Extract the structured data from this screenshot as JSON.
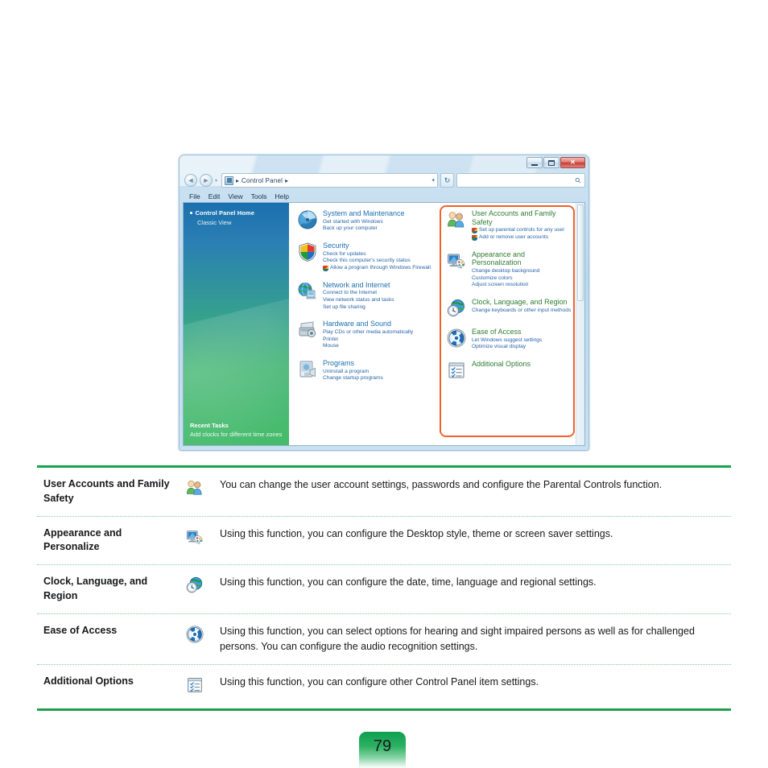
{
  "window": {
    "caption": {
      "minimize": "–",
      "maximize": "□",
      "close": "✕"
    },
    "nav": {
      "back_icon": "back-arrow-icon",
      "forward_icon": "forward-arrow-icon",
      "history_caret": "▾",
      "address_icon": "control-panel-icon",
      "breadcrumb_sep_1": "▸",
      "breadcrumb_label": "Control Panel",
      "breadcrumb_sep_2": "▸",
      "address_dropdown": "▾",
      "refresh_label": "↻",
      "search_placeholder": "",
      "search_value": "",
      "search_icon": "magnifier-icon"
    },
    "menubar": [
      "File",
      "Edit",
      "View",
      "Tools",
      "Help"
    ],
    "sidebar": {
      "home": "Control Panel Home",
      "classic_view": "Classic View",
      "recent_title": "Recent Tasks",
      "recent_items": [
        "Add clocks for different time zones"
      ]
    },
    "left_categories": [
      {
        "icon": "system-maintenance-icon",
        "title": "System and Maintenance",
        "links": [
          {
            "text": "Get started with Windows",
            "shield": false
          },
          {
            "text": "Back up your computer",
            "shield": false
          }
        ]
      },
      {
        "icon": "security-shield-icon",
        "title": "Security",
        "links": [
          {
            "text": "Check for updates",
            "shield": false
          },
          {
            "text": "Check this computer's security status",
            "shield": false
          },
          {
            "text": "Allow a program through Windows Firewall",
            "shield": true
          }
        ]
      },
      {
        "icon": "network-internet-icon",
        "title": "Network and Internet",
        "links": [
          {
            "text": "Connect to the Internet",
            "shield": false
          },
          {
            "text": "View network status and tasks",
            "shield": false
          },
          {
            "text": "Set up file sharing",
            "shield": false
          }
        ]
      },
      {
        "icon": "hardware-sound-icon",
        "title": "Hardware and Sound",
        "links": [
          {
            "text": "Play CDs or other media automatically",
            "shield": false
          },
          {
            "text": "Printer",
            "shield": false
          },
          {
            "text": "Mouse",
            "shield": false
          }
        ]
      },
      {
        "icon": "programs-icon",
        "title": "Programs",
        "links": [
          {
            "text": "Uninstall a program",
            "shield": false
          },
          {
            "text": "Change startup programs",
            "shield": false
          }
        ]
      }
    ],
    "right_categories": [
      {
        "icon": "user-accounts-icon",
        "title": "User Accounts and Family Safety",
        "links": [
          {
            "text": "Set up parental controls for any user",
            "shield": true
          },
          {
            "text": "Add or remove user accounts",
            "shield": true
          }
        ]
      },
      {
        "icon": "appearance-personalization-icon",
        "title": "Appearance and Personalization",
        "links": [
          {
            "text": "Change desktop background",
            "shield": false
          },
          {
            "text": "Customize colors",
            "shield": false
          },
          {
            "text": "Adjust screen resolution",
            "shield": false
          }
        ]
      },
      {
        "icon": "clock-language-region-icon",
        "title": "Clock, Language, and Region",
        "links": [
          {
            "text": "Change keyboards or other input methods",
            "shield": false
          }
        ]
      },
      {
        "icon": "ease-of-access-icon",
        "title": "Ease of Access",
        "links": [
          {
            "text": "Let Windows suggest settings",
            "shield": false
          },
          {
            "text": "Optimize visual display",
            "shield": false
          }
        ]
      },
      {
        "icon": "additional-options-icon",
        "title": "Additional Options",
        "links": []
      }
    ],
    "highlight_color": "#f0612c"
  },
  "table": {
    "accent_color": "#19a14b",
    "rows": [
      {
        "label": "User Accounts and Family Safety",
        "icon": "user-accounts-icon",
        "description": "You can change the user account settings, passwords and configure the Parental Controls function."
      },
      {
        "label": "Appearance and Personalize",
        "icon": "appearance-personalization-icon",
        "description": "Using this function, you can configure the Desktop style, theme or screen saver settings."
      },
      {
        "label": "Clock, Language, and Region",
        "icon": "clock-language-region-icon",
        "description": "Using this function, you can configure the date, time, language and regional settings."
      },
      {
        "label": "Ease of Access",
        "icon": "ease-of-access-icon",
        "description": "Using this function, you can select options for hearing and sight impaired persons as well as for challenged persons. You can configure the audio recognition settings."
      },
      {
        "label": "Additional Options",
        "icon": "additional-options-icon",
        "description": "Using this function, you can configure other Control Panel item settings."
      }
    ]
  },
  "page_number": "79"
}
